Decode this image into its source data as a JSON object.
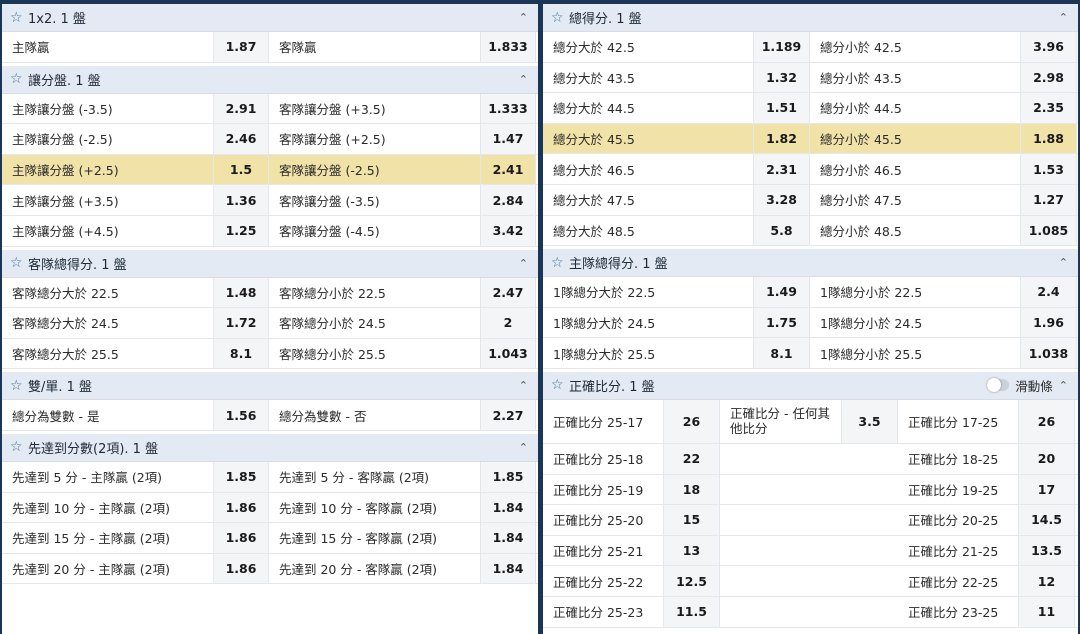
{
  "left": [
    {
      "title": "1x2. 1 盤",
      "rows": [
        {
          "a": "主隊贏",
          "ao": "1.87",
          "b": "客隊贏",
          "bo": "1.833"
        }
      ]
    },
    {
      "title": "讓分盤. 1 盤",
      "rows": [
        {
          "a": "主隊讓分盤 (-3.5)",
          "ao": "2.91",
          "b": "客隊讓分盤 (+3.5)",
          "bo": "1.333"
        },
        {
          "a": "主隊讓分盤 (-2.5)",
          "ao": "2.46",
          "b": "客隊讓分盤 (+2.5)",
          "bo": "1.47"
        },
        {
          "a": "主隊讓分盤 (+2.5)",
          "ao": "1.5",
          "b": "客隊讓分盤 (-2.5)",
          "bo": "2.41",
          "highlight": true
        },
        {
          "a": "主隊讓分盤 (+3.5)",
          "ao": "1.36",
          "b": "客隊讓分盤 (-3.5)",
          "bo": "2.84"
        },
        {
          "a": "主隊讓分盤 (+4.5)",
          "ao": "1.25",
          "b": "客隊讓分盤 (-4.5)",
          "bo": "3.42"
        }
      ]
    },
    {
      "title": "客隊總得分. 1 盤",
      "rows": [
        {
          "a": "客隊總分大於 22.5",
          "ao": "1.48",
          "b": "客隊總分小於 22.5",
          "bo": "2.47"
        },
        {
          "a": "客隊總分大於 24.5",
          "ao": "1.72",
          "b": "客隊總分小於 24.5",
          "bo": "2"
        },
        {
          "a": "客隊總分大於 25.5",
          "ao": "8.1",
          "b": "客隊總分小於 25.5",
          "bo": "1.043"
        }
      ]
    },
    {
      "title": "雙/單. 1 盤",
      "rows": [
        {
          "a": "總分為雙數 - 是",
          "ao": "1.56",
          "b": "總分為雙數 - 否",
          "bo": "2.27"
        }
      ]
    },
    {
      "title": "先達到分數(2項). 1 盤",
      "rows": [
        {
          "a": "先達到 5 分 - 主隊贏 (2項)",
          "ao": "1.85",
          "b": "先達到 5 分 - 客隊贏 (2項)",
          "bo": "1.85"
        },
        {
          "a": "先達到 10 分 - 主隊贏 (2項)",
          "ao": "1.86",
          "b": "先達到 10 分 - 客隊贏 (2項)",
          "bo": "1.84"
        },
        {
          "a": "先達到 15 分 - 主隊贏 (2項)",
          "ao": "1.86",
          "b": "先達到 15 分 - 客隊贏 (2項)",
          "bo": "1.84"
        },
        {
          "a": "先達到 20 分 - 主隊贏 (2項)",
          "ao": "1.86",
          "b": "先達到 20 分 - 客隊贏 (2項)",
          "bo": "1.84"
        }
      ]
    }
  ],
  "right": [
    {
      "title": "總得分. 1 盤",
      "rows": [
        {
          "a": "總分大於 42.5",
          "ao": "1.189",
          "b": "總分小於 42.5",
          "bo": "3.96"
        },
        {
          "a": "總分大於 43.5",
          "ao": "1.32",
          "b": "總分小於 43.5",
          "bo": "2.98"
        },
        {
          "a": "總分大於 44.5",
          "ao": "1.51",
          "b": "總分小於 44.5",
          "bo": "2.35"
        },
        {
          "a": "總分大於 45.5",
          "ao": "1.82",
          "b": "總分小於 45.5",
          "bo": "1.88",
          "highlight": true
        },
        {
          "a": "總分大於 46.5",
          "ao": "2.31",
          "b": "總分小於 46.5",
          "bo": "1.53"
        },
        {
          "a": "總分大於 47.5",
          "ao": "3.28",
          "b": "總分小於 47.5",
          "bo": "1.27"
        },
        {
          "a": "總分大於 48.5",
          "ao": "5.8",
          "b": "總分小於 48.5",
          "bo": "1.085"
        }
      ]
    },
    {
      "title": "主隊總得分. 1 盤",
      "rows": [
        {
          "a": "1隊總分大於 22.5",
          "ao": "1.49",
          "b": "1隊總分小於 22.5",
          "bo": "2.4"
        },
        {
          "a": "1隊總分大於 24.5",
          "ao": "1.75",
          "b": "1隊總分小於 24.5",
          "bo": "1.96"
        },
        {
          "a": "1隊總分大於 25.5",
          "ao": "8.1",
          "b": "1隊總分小於 25.5",
          "bo": "1.038"
        }
      ]
    }
  ],
  "correct_score": {
    "title": "正確比分. 1 盤",
    "slider_label": "滑動條",
    "rows": [
      {
        "a": "正確比分 25-17",
        "ao": "26",
        "m": "正確比分 - 任何其他比分",
        "mo": "3.5",
        "b": "正確比分 17-25",
        "bo": "26"
      },
      {
        "a": "正確比分 25-18",
        "ao": "22",
        "b": "正確比分 18-25",
        "bo": "20"
      },
      {
        "a": "正確比分 25-19",
        "ao": "18",
        "b": "正確比分 19-25",
        "bo": "17"
      },
      {
        "a": "正確比分 25-20",
        "ao": "15",
        "b": "正確比分 20-25",
        "bo": "14.5"
      },
      {
        "a": "正確比分 25-21",
        "ao": "13",
        "b": "正確比分 21-25",
        "bo": "13.5"
      },
      {
        "a": "正確比分 25-22",
        "ao": "12.5",
        "b": "正確比分 22-25",
        "bo": "12"
      },
      {
        "a": "正確比分 25-23",
        "ao": "11.5",
        "b": "正確比分 23-25",
        "bo": "11"
      }
    ]
  },
  "icons": {
    "star": "star-icon",
    "collapse": "chevron-up-icon"
  },
  "colors": {
    "background": "#1b3557",
    "header": "#e3eaf3",
    "highlight": "#f1e2a8",
    "star": "#3f6f9e"
  }
}
